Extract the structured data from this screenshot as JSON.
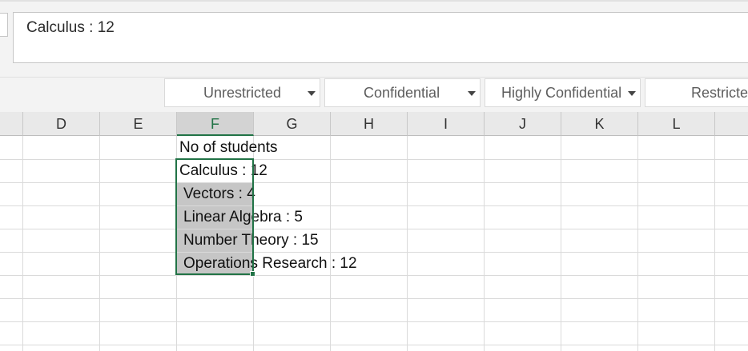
{
  "formula_bar": {
    "value": "Calculus : 12"
  },
  "sensitivity_labels": [
    {
      "label": "Unrestricted",
      "has_dropdown": true
    },
    {
      "label": "Confidential",
      "has_dropdown": true
    },
    {
      "label": "Highly Confidential",
      "has_dropdown": true
    },
    {
      "label": "Restricted",
      "has_dropdown": false
    }
  ],
  "columns": [
    "D",
    "E",
    "F",
    "G",
    "H",
    "I",
    "J",
    "K",
    "L"
  ],
  "selected_column": "F",
  "cells": [
    {
      "ref": "F1",
      "text": "No of students"
    },
    {
      "ref": "F2",
      "text": "Calculus : 12"
    },
    {
      "ref": "F3",
      "text": "Vectors : 4"
    },
    {
      "ref": "F4",
      "text": "Linear Algebra : 5"
    },
    {
      "ref": "F5",
      "text": "Number Theory : 15"
    },
    {
      "ref": "F6",
      "text": "Operations Research : 12"
    }
  ],
  "colors": {
    "selection": "#217346",
    "selected_fill": "#c6c6c6",
    "header_bg": "#e9e9e9"
  },
  "icons": {
    "dropdown": "chevron-down-icon"
  }
}
